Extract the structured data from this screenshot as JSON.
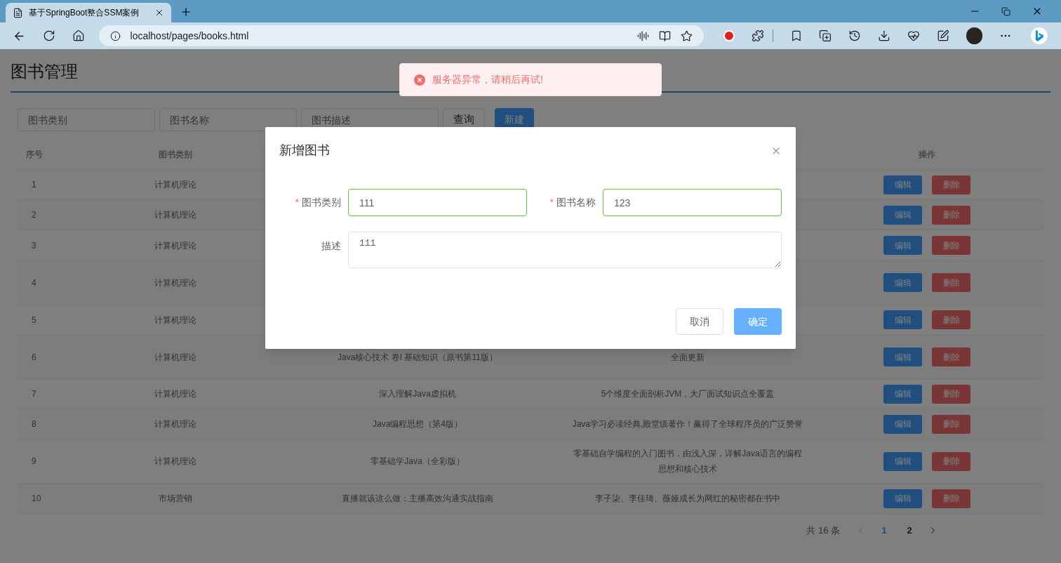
{
  "browser": {
    "tab": {
      "title": "基于SpringBoot整合SSM案例"
    },
    "address": "localhost/pages/books.html"
  },
  "page": {
    "title": "图书管理"
  },
  "filters": [
    {
      "placeholder": "图书类别"
    },
    {
      "placeholder": "图书名称"
    },
    {
      "placeholder": "图书描述"
    }
  ],
  "toolbar": {
    "query": "查询",
    "create": "新建"
  },
  "table": {
    "headers": {
      "index": "序号",
      "category": "图书类别",
      "actions": "操作"
    },
    "rows": [
      {
        "index": "1",
        "category": "计算机理论",
        "edit": "编辑",
        "delete": "删除"
      },
      {
        "index": "2",
        "category": "计算机理论",
        "edit": "编辑",
        "delete": "删除"
      },
      {
        "index": "3",
        "category": "计算机理论",
        "edit": "编辑",
        "delete": "删除"
      },
      {
        "index": "4",
        "category": "计算机理论",
        "edit": "编辑",
        "delete": "删除"
      },
      {
        "index": "5",
        "category": "计算机理论",
        "edit": "编辑",
        "delete": "删除"
      },
      {
        "index": "6",
        "category": "计算机理论",
        "name": "Java核心技术 卷I 基础知识（原书第11版）",
        "description": "全面更新",
        "edit": "编辑",
        "delete": "删除"
      },
      {
        "index": "7",
        "category": "计算机理论",
        "name": "深入理解Java虚拟机",
        "description": "5个维度全面剖析JVM，大厂面试知识点全覆盖",
        "edit": "编辑",
        "delete": "删除"
      },
      {
        "index": "8",
        "category": "计算机理论",
        "name": "Java编程思想（第4版）",
        "description": "Java学习必读经典,殿堂级著作！赢得了全球程序员的广泛赞誉",
        "edit": "编辑",
        "delete": "删除"
      },
      {
        "index": "9",
        "category": "计算机理论",
        "name": "零基础学Java（全彩版）",
        "description": "零基础自学编程的入门图书，由浅入深，详解Java语言的编程思想和核心技术",
        "edit": "编辑",
        "delete": "删除"
      },
      {
        "index": "10",
        "category": "市场营销",
        "name": "直播就该这么做：主播高效沟通实战指南",
        "description": "李子柒、李佳琦、薇娅成长为网红的秘密都在书中",
        "edit": "编辑",
        "delete": "删除"
      }
    ]
  },
  "pagination": {
    "total": "共 16 条",
    "pages": [
      {
        "label": "1",
        "selected": true
      },
      {
        "label": "2",
        "selected": false
      }
    ]
  },
  "toast": {
    "message": "服务器异常，请稍后再试!"
  },
  "dialog": {
    "title": "新增图书",
    "fields": [
      {
        "kind": "input",
        "required_mark": "*",
        "label": "图书类别",
        "validated": true,
        "value": "111"
      },
      {
        "kind": "input",
        "required_mark": "*",
        "label": "图书名称",
        "validated": true,
        "value": "123"
      },
      {
        "kind": "textarea",
        "label": "描述",
        "validated": false,
        "value": "111"
      }
    ],
    "cancel": "取消",
    "confirm": "确定"
  }
}
